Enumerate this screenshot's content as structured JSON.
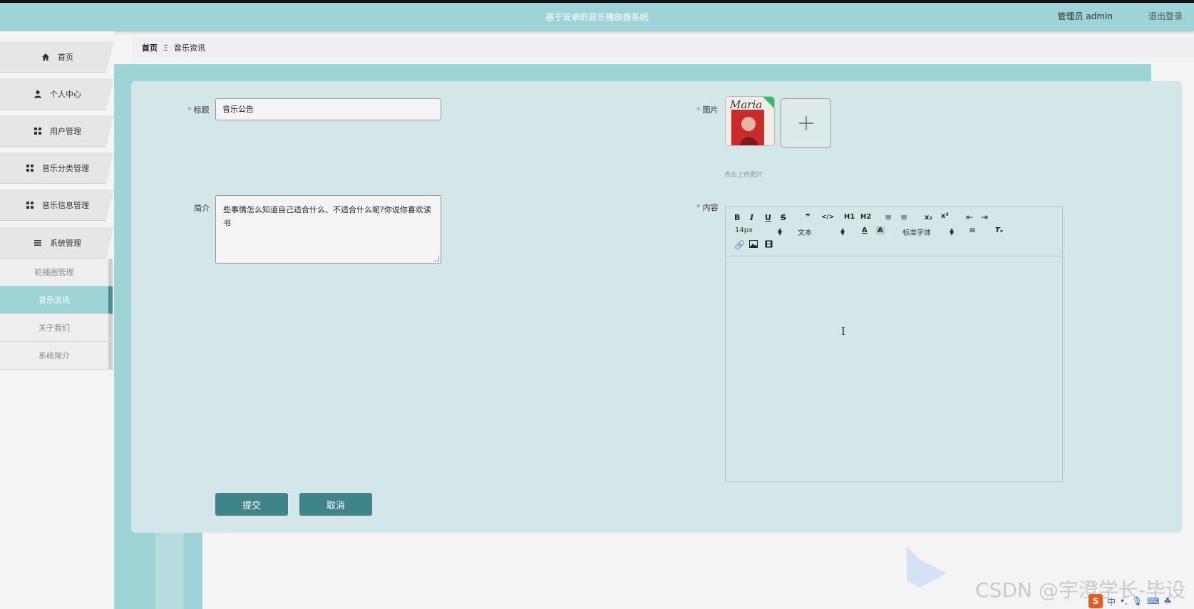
{
  "header": {
    "title": "基于安卓的音乐播放器系统",
    "user": "管理员 admin",
    "logout": "退出登录"
  },
  "sidebar": {
    "items": [
      {
        "label": "首页",
        "icon": "home-icon"
      },
      {
        "label": "个人中心",
        "icon": "user-icon"
      },
      {
        "label": "用户管理",
        "icon": "grid-icon"
      },
      {
        "label": "音乐分类管理",
        "icon": "grid-icon"
      },
      {
        "label": "音乐信息管理",
        "icon": "grid-icon"
      },
      {
        "label": "系统管理",
        "icon": "list-icon"
      }
    ],
    "sub_items": [
      {
        "label": "轮播图管理",
        "active": false
      },
      {
        "label": "音乐资讯",
        "active": true
      },
      {
        "label": "关于我们",
        "active": false
      },
      {
        "label": "系统简介",
        "active": false
      }
    ]
  },
  "breadcrumb": {
    "home": "首页",
    "separator": "Ξ",
    "current": "音乐资讯"
  },
  "form": {
    "title_label": "标题",
    "title_value": "音乐公告",
    "intro_label": "简介",
    "intro_value": "些事情怎么知道自己适合什么、不适合什么呢?你说你喜欢读书",
    "image_label": "图片",
    "image_thumb_text": "Maria",
    "upload_tip": "点击上传图片",
    "content_label": "内容",
    "submit_label": "提交",
    "cancel_label": "取消"
  },
  "editor": {
    "font_size": "14px",
    "text_style": "文本",
    "font_family": "标准字体",
    "h1": "H1",
    "h2": "H2"
  },
  "watermark": "CSDN @宇澄学长-毕设",
  "ime": {
    "logo": "S",
    "mode": "中"
  },
  "colors": {
    "header_bg": "#9fd4d6",
    "card_bg": "#d3e7e8",
    "button_bg": "#3f8486",
    "active_sub_bg": "#9fd4d6"
  }
}
